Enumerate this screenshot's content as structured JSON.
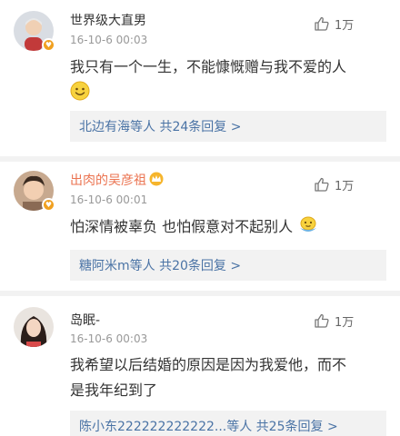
{
  "comments": [
    {
      "username": "世界级大直男",
      "time": "16-10-6 00:03",
      "likes": "1万",
      "text": "我只有一个一生，不能慷慨赠与我不爱的人",
      "emoji": "smile-emoji",
      "replies": "北边有海等人  共24条回复 >"
    },
    {
      "username": "出肉的吴彦祖",
      "time": "16-10-6 00:01",
      "likes": "1万",
      "text": "怕深情被辜负 也怕假意对不起别人",
      "emoji": "emoji-sweat",
      "replies": "糖阿米m等人  共20条回复 >"
    },
    {
      "username": "岛眠-",
      "time": "16-10-6 00:03",
      "likes": "1万",
      "text_line1": "我希望以后结婚的原因是因为我爱他，而不",
      "text_line2": "是我年纪到了",
      "replies": "陈小东222222222222...等人  共25条回复 >"
    }
  ],
  "colors": {
    "username": "#333333",
    "username_vip": "#eb7350",
    "reply_link": "#4a73a5",
    "reply_bg": "#f2f2f2",
    "timestamp": "#999999",
    "badge": "#f0a020"
  }
}
